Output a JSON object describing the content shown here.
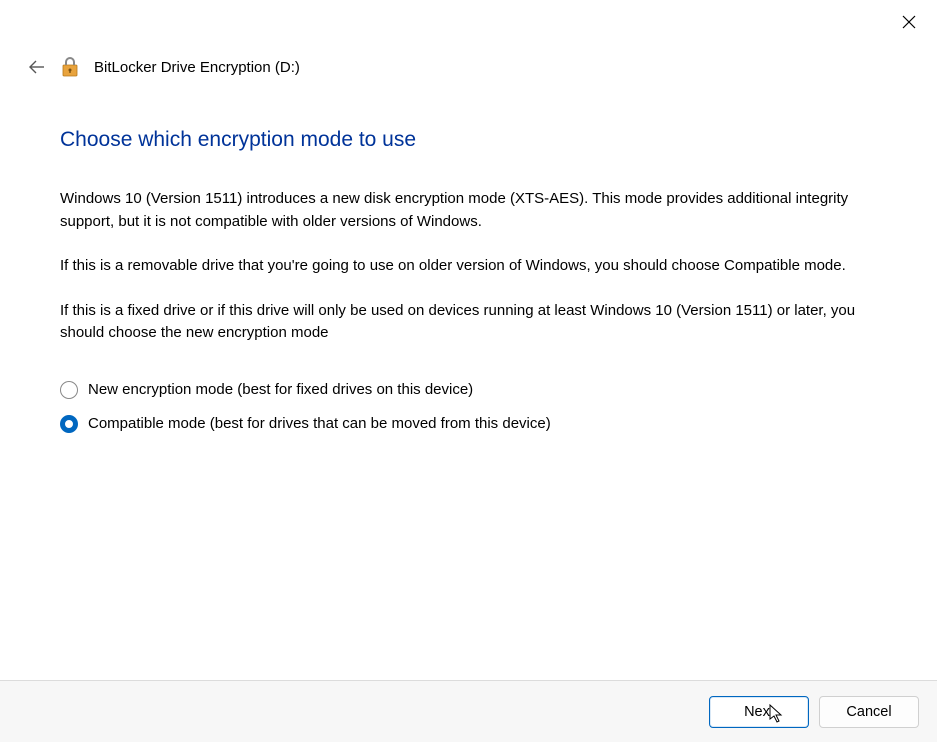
{
  "titlebar": {
    "close_label": "Close"
  },
  "header": {
    "title": "BitLocker Drive Encryption (D:)"
  },
  "content": {
    "heading": "Choose which encryption mode to use",
    "paragraph1": "Windows 10 (Version 1511) introduces a new disk encryption mode (XTS-AES). This mode provides additional integrity support, but it is not compatible with older versions of Windows.",
    "paragraph2": "If this is a removable drive that you're going to use on older version of Windows, you should choose Compatible mode.",
    "paragraph3": "If this is a fixed drive or if this drive will only be used on devices running at least Windows 10 (Version 1511) or later, you should choose the new encryption mode"
  },
  "options": {
    "new_mode": "New encryption mode (best for fixed drives on this device)",
    "compatible_mode": "Compatible mode (best for drives that can be moved from this device)",
    "selected": "compatible_mode"
  },
  "footer": {
    "next_label": "Next",
    "cancel_label": "Cancel"
  },
  "colors": {
    "accent": "#0067c0",
    "heading": "#003399"
  }
}
